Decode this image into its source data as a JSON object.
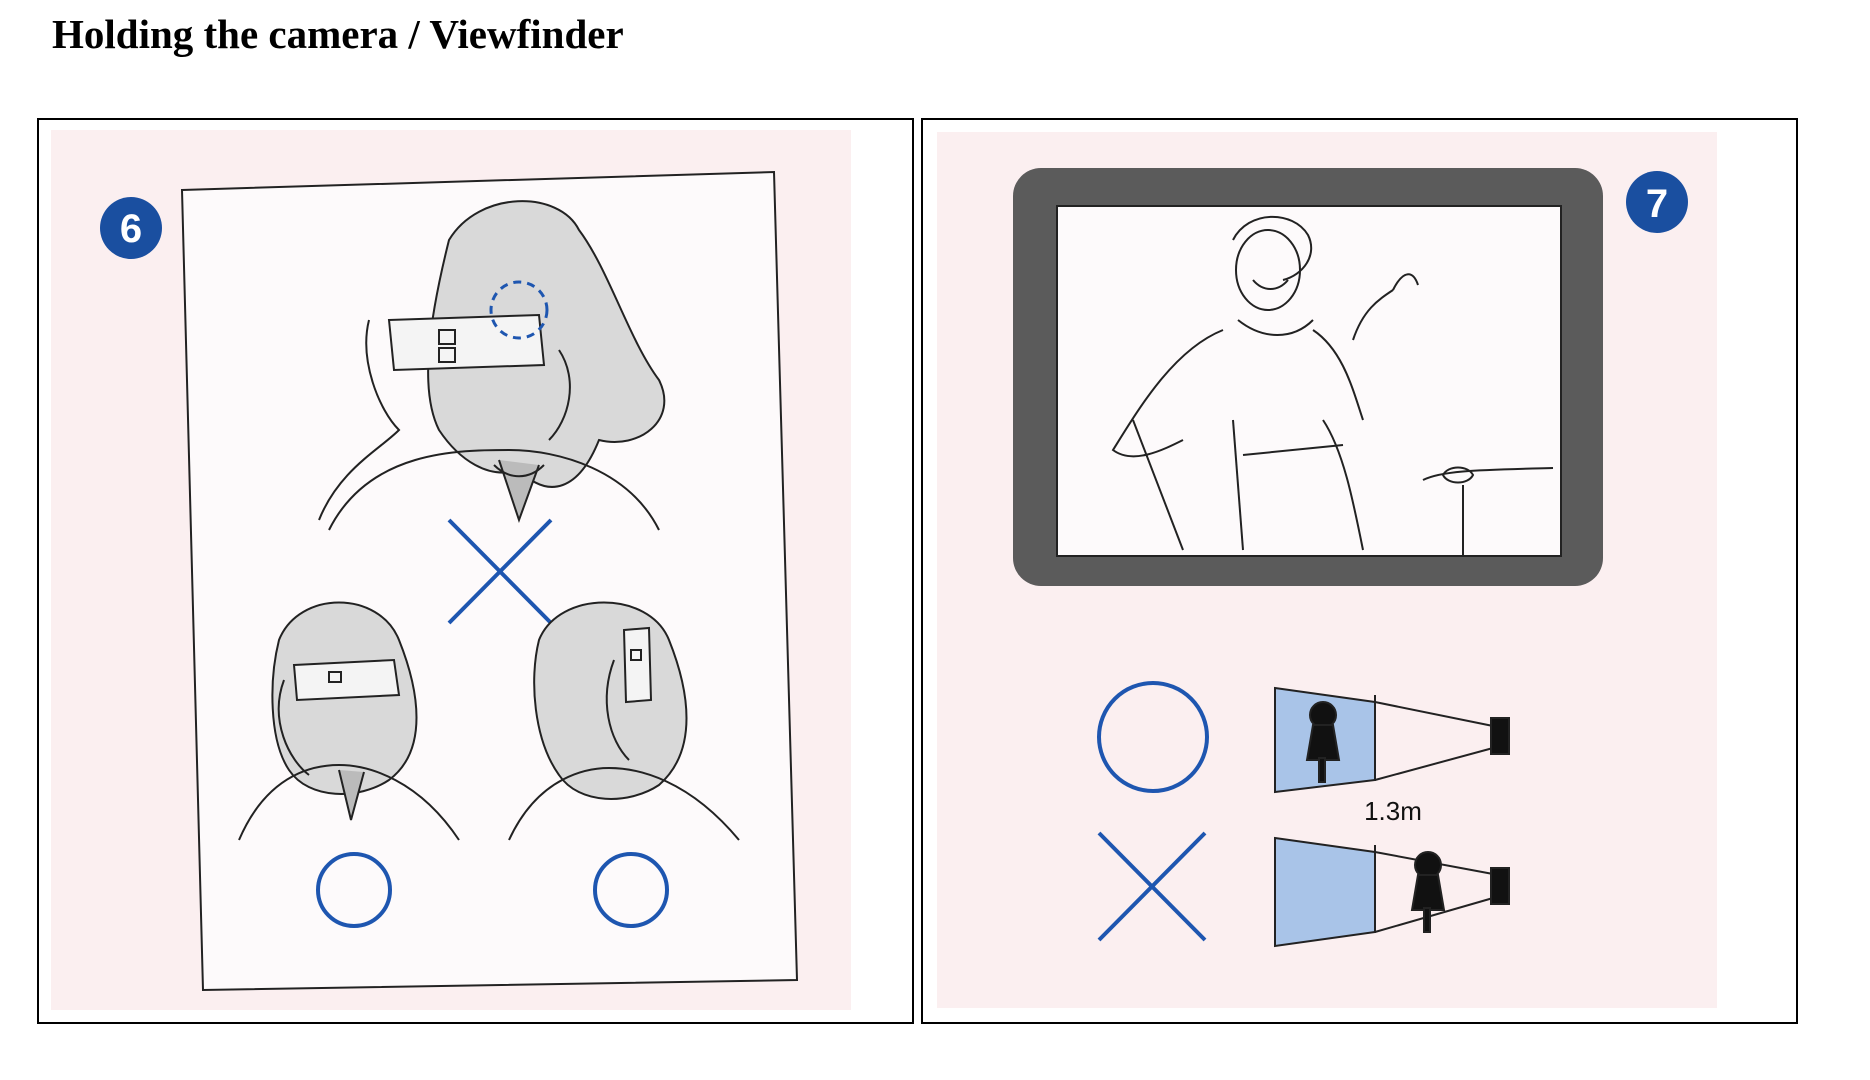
{
  "page": {
    "title": "Holding the camera / Viewfinder"
  },
  "figures": [
    {
      "badge": "6",
      "accent": "#1a4fa0"
    },
    {
      "badge": "7",
      "accent": "#1a4fa0",
      "distance_label": "1.3m"
    }
  ],
  "colors": {
    "paper": "#fbeff0",
    "marker_blue": "#1e56b0",
    "frame_gray": "#5b5b5b",
    "wedge_blue": "#a9c4e8"
  }
}
